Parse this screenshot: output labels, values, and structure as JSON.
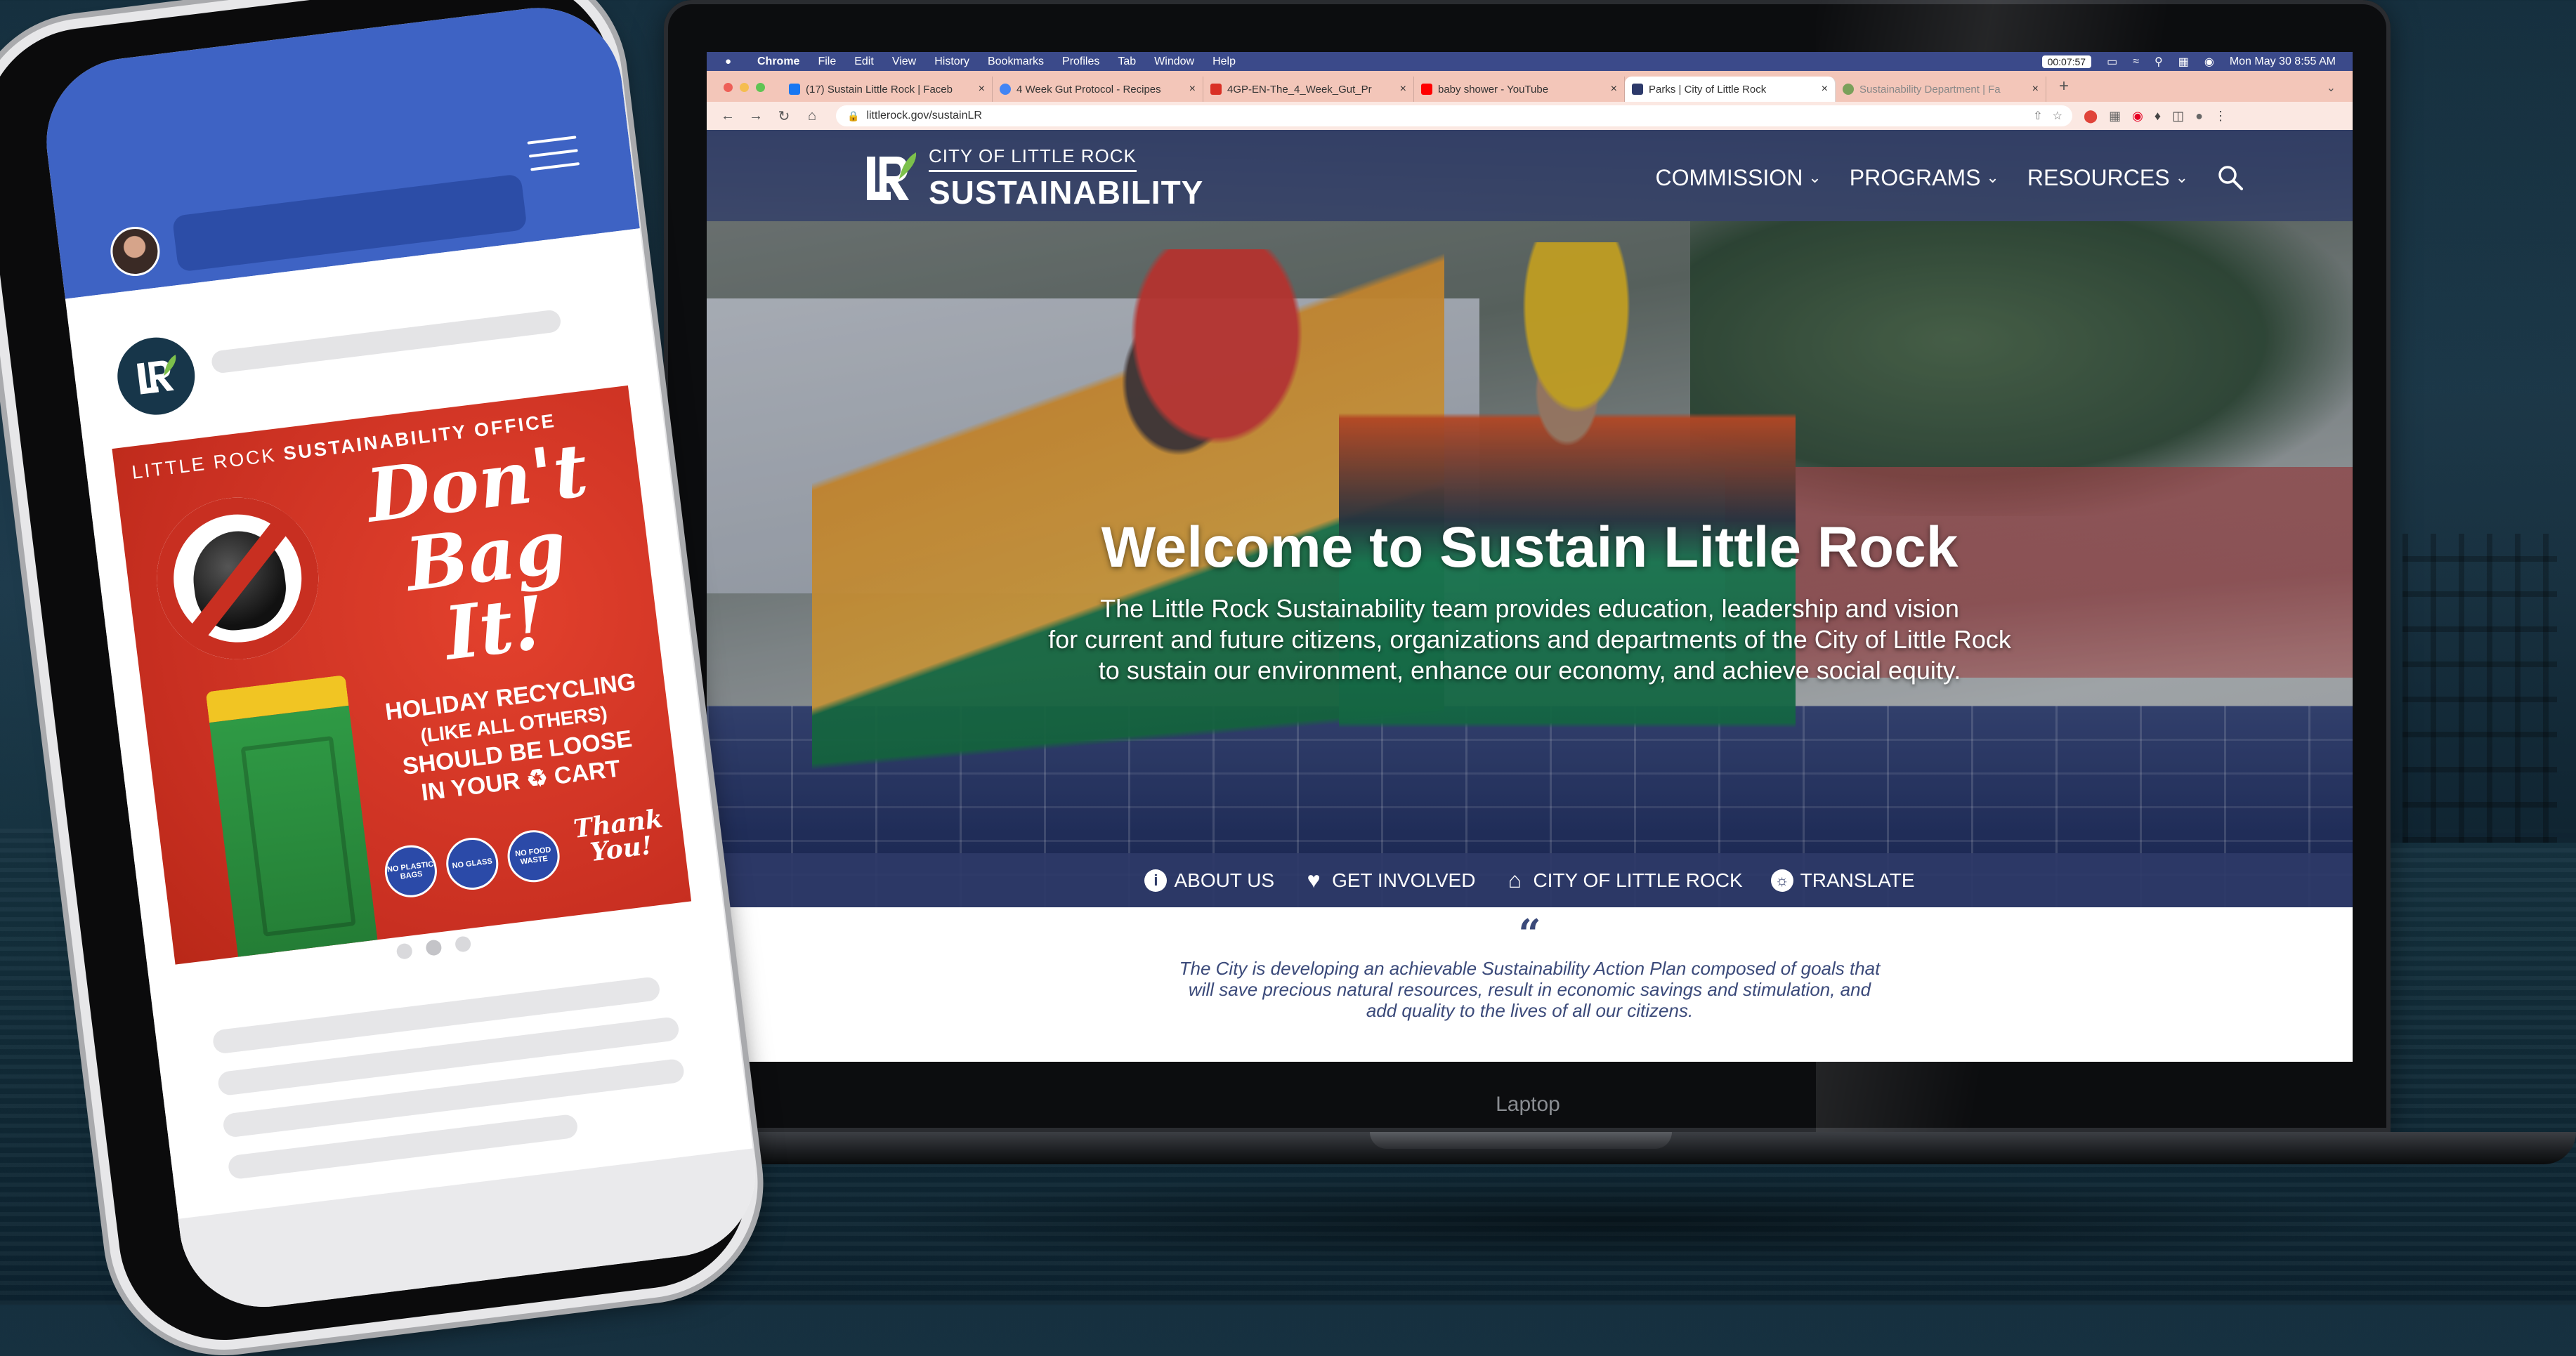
{
  "browser": {
    "menubar": {
      "app": "Chrome",
      "items": [
        "File",
        "Edit",
        "View",
        "History",
        "Bookmarks",
        "Profiles",
        "Tab",
        "Window",
        "Help"
      ],
      "timer": "00:07:57",
      "datetime": "Mon May 30  8:55 AM"
    },
    "tabs": [
      {
        "title": "(17) Sustain Little Rock | Faceb",
        "favicon_color": "#1877f2",
        "active": false
      },
      {
        "title": "4 Week Gut Protocol - Recipes",
        "favicon_color": "#4285f4",
        "active": false
      },
      {
        "title": "4GP-EN-The_4_Week_Gut_Pr",
        "favicon_color": "#d93025",
        "active": false
      },
      {
        "title": "baby shower - YouTube",
        "favicon_color": "#ff0000",
        "active": false
      },
      {
        "title": "Parks | City of Little Rock",
        "favicon_color": "#2d3a6b",
        "active": true
      },
      {
        "title": "Sustainability Department | Fa",
        "favicon_color": "#7aa05a",
        "active": false
      }
    ],
    "address": "littlerock.gov/sustainLR",
    "colors": {
      "menubar": "#3b4a8a",
      "tabstrip": "#f3c6b9"
    }
  },
  "site": {
    "logo": {
      "small": "City of Little Rock",
      "big": "SUSTAINABILITY"
    },
    "nav": [
      {
        "label": "COMMISSION"
      },
      {
        "label": "PROGRAMS"
      },
      {
        "label": "RESOURCES"
      }
    ],
    "hero": {
      "title": "Welcome to Sustain Little Rock",
      "subtitle_lines": [
        "The Little Rock Sustainability team provides education, leadership and vision",
        "for current and future citizens, organizations and departments of the City of Little Rock",
        "to sustain our environment, enhance our economy, and achieve social equity."
      ]
    },
    "quicklinks": [
      {
        "label": "ABOUT US",
        "icon": "info-icon"
      },
      {
        "label": "GET INVOLVED",
        "icon": "heart-icon"
      },
      {
        "label": "CITY OF LITTLE ROCK",
        "icon": "home-icon"
      },
      {
        "label": "TRANSLATE",
        "icon": "translate-icon"
      }
    ],
    "quote": {
      "mark": "“",
      "lines": [
        "The City is developing an achievable Sustainability Action Plan composed of goals that",
        "will save precious natural resources, result in economic savings and stimulation, and",
        "add quality to the lives of all our citizens."
      ]
    }
  },
  "laptop": {
    "brand": "Laptop"
  },
  "phone_post": {
    "office_prefix": "LITTLE ROCK",
    "office_bold": "SUSTAINABILITY OFFICE",
    "headline": [
      "Don't",
      "Bag",
      "It!"
    ],
    "body": [
      "HOLIDAY RECYCLING",
      "(LIKE ALL OTHERS)",
      "SHOULD BE LOOSE",
      "IN YOUR",
      "CART"
    ],
    "badges": [
      "NO PLASTIC BAGS",
      "NO GLASS",
      "NO FOOD WASTE"
    ],
    "thanks": [
      "Thank",
      "You!"
    ],
    "colors": {
      "poster": "#c82f21",
      "facebook": "#3e63c4"
    }
  }
}
